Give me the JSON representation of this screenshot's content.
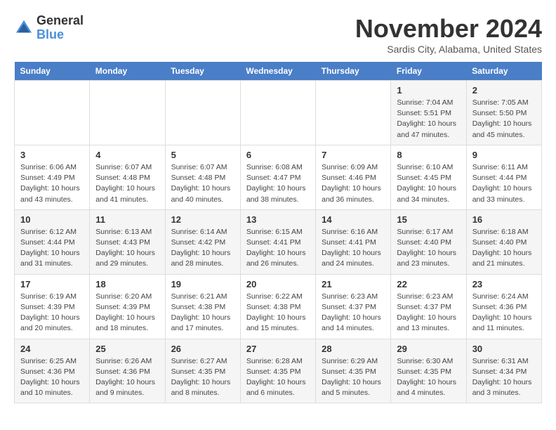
{
  "logo": {
    "line1": "General",
    "line2": "Blue"
  },
  "header": {
    "month": "November 2024",
    "location": "Sardis City, Alabama, United States"
  },
  "weekdays": [
    "Sunday",
    "Monday",
    "Tuesday",
    "Wednesday",
    "Thursday",
    "Friday",
    "Saturday"
  ],
  "weeks": [
    [
      {
        "day": "",
        "info": ""
      },
      {
        "day": "",
        "info": ""
      },
      {
        "day": "",
        "info": ""
      },
      {
        "day": "",
        "info": ""
      },
      {
        "day": "",
        "info": ""
      },
      {
        "day": "1",
        "info": "Sunrise: 7:04 AM\nSunset: 5:51 PM\nDaylight: 10 hours\nand 47 minutes."
      },
      {
        "day": "2",
        "info": "Sunrise: 7:05 AM\nSunset: 5:50 PM\nDaylight: 10 hours\nand 45 minutes."
      }
    ],
    [
      {
        "day": "3",
        "info": "Sunrise: 6:06 AM\nSunset: 4:49 PM\nDaylight: 10 hours\nand 43 minutes."
      },
      {
        "day": "4",
        "info": "Sunrise: 6:07 AM\nSunset: 4:48 PM\nDaylight: 10 hours\nand 41 minutes."
      },
      {
        "day": "5",
        "info": "Sunrise: 6:07 AM\nSunset: 4:48 PM\nDaylight: 10 hours\nand 40 minutes."
      },
      {
        "day": "6",
        "info": "Sunrise: 6:08 AM\nSunset: 4:47 PM\nDaylight: 10 hours\nand 38 minutes."
      },
      {
        "day": "7",
        "info": "Sunrise: 6:09 AM\nSunset: 4:46 PM\nDaylight: 10 hours\nand 36 minutes."
      },
      {
        "day": "8",
        "info": "Sunrise: 6:10 AM\nSunset: 4:45 PM\nDaylight: 10 hours\nand 34 minutes."
      },
      {
        "day": "9",
        "info": "Sunrise: 6:11 AM\nSunset: 4:44 PM\nDaylight: 10 hours\nand 33 minutes."
      }
    ],
    [
      {
        "day": "10",
        "info": "Sunrise: 6:12 AM\nSunset: 4:44 PM\nDaylight: 10 hours\nand 31 minutes."
      },
      {
        "day": "11",
        "info": "Sunrise: 6:13 AM\nSunset: 4:43 PM\nDaylight: 10 hours\nand 29 minutes."
      },
      {
        "day": "12",
        "info": "Sunrise: 6:14 AM\nSunset: 4:42 PM\nDaylight: 10 hours\nand 28 minutes."
      },
      {
        "day": "13",
        "info": "Sunrise: 6:15 AM\nSunset: 4:41 PM\nDaylight: 10 hours\nand 26 minutes."
      },
      {
        "day": "14",
        "info": "Sunrise: 6:16 AM\nSunset: 4:41 PM\nDaylight: 10 hours\nand 24 minutes."
      },
      {
        "day": "15",
        "info": "Sunrise: 6:17 AM\nSunset: 4:40 PM\nDaylight: 10 hours\nand 23 minutes."
      },
      {
        "day": "16",
        "info": "Sunrise: 6:18 AM\nSunset: 4:40 PM\nDaylight: 10 hours\nand 21 minutes."
      }
    ],
    [
      {
        "day": "17",
        "info": "Sunrise: 6:19 AM\nSunset: 4:39 PM\nDaylight: 10 hours\nand 20 minutes."
      },
      {
        "day": "18",
        "info": "Sunrise: 6:20 AM\nSunset: 4:39 PM\nDaylight: 10 hours\nand 18 minutes."
      },
      {
        "day": "19",
        "info": "Sunrise: 6:21 AM\nSunset: 4:38 PM\nDaylight: 10 hours\nand 17 minutes."
      },
      {
        "day": "20",
        "info": "Sunrise: 6:22 AM\nSunset: 4:38 PM\nDaylight: 10 hours\nand 15 minutes."
      },
      {
        "day": "21",
        "info": "Sunrise: 6:23 AM\nSunset: 4:37 PM\nDaylight: 10 hours\nand 14 minutes."
      },
      {
        "day": "22",
        "info": "Sunrise: 6:23 AM\nSunset: 4:37 PM\nDaylight: 10 hours\nand 13 minutes."
      },
      {
        "day": "23",
        "info": "Sunrise: 6:24 AM\nSunset: 4:36 PM\nDaylight: 10 hours\nand 11 minutes."
      }
    ],
    [
      {
        "day": "24",
        "info": "Sunrise: 6:25 AM\nSunset: 4:36 PM\nDaylight: 10 hours\nand 10 minutes."
      },
      {
        "day": "25",
        "info": "Sunrise: 6:26 AM\nSunset: 4:36 PM\nDaylight: 10 hours\nand 9 minutes."
      },
      {
        "day": "26",
        "info": "Sunrise: 6:27 AM\nSunset: 4:35 PM\nDaylight: 10 hours\nand 8 minutes."
      },
      {
        "day": "27",
        "info": "Sunrise: 6:28 AM\nSunset: 4:35 PM\nDaylight: 10 hours\nand 6 minutes."
      },
      {
        "day": "28",
        "info": "Sunrise: 6:29 AM\nSunset: 4:35 PM\nDaylight: 10 hours\nand 5 minutes."
      },
      {
        "day": "29",
        "info": "Sunrise: 6:30 AM\nSunset: 4:35 PM\nDaylight: 10 hours\nand 4 minutes."
      },
      {
        "day": "30",
        "info": "Sunrise: 6:31 AM\nSunset: 4:34 PM\nDaylight: 10 hours\nand 3 minutes."
      }
    ]
  ]
}
